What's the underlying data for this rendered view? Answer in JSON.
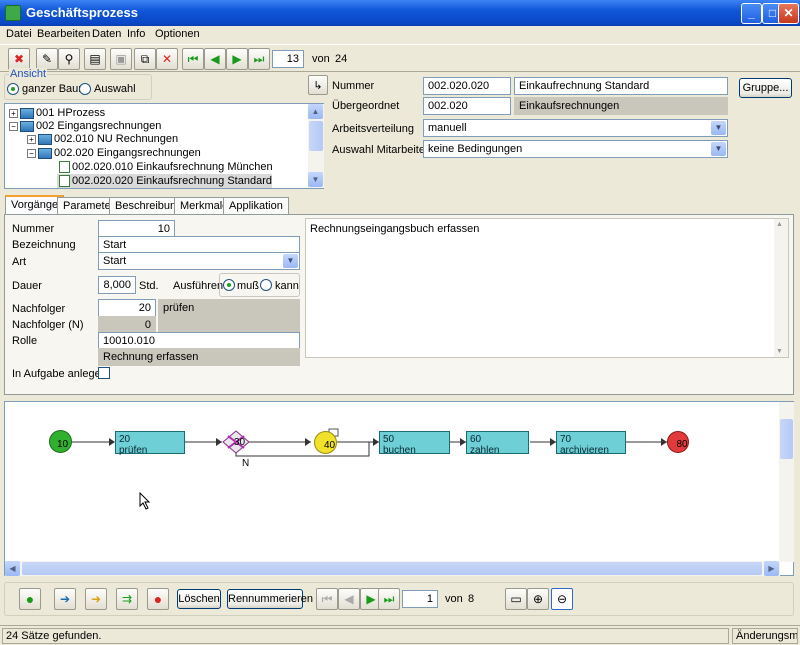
{
  "window": {
    "title": "Geschäftsprozess"
  },
  "menu": [
    "Datei",
    "Bearbeiten",
    "Daten",
    "Info",
    "Optionen"
  ],
  "nav": {
    "current": "13",
    "of_label": "von",
    "total": "24"
  },
  "ansicht": {
    "legend": "Ansicht",
    "option1": "ganzer Baum",
    "option2": "Auswahl"
  },
  "tree": {
    "items": [
      "001 HProzess",
      "002 Eingangsrechnungen",
      "002.010 NU Rechnungen",
      "002.020 Eingangsrechnungen",
      "002.020.010 Einkaufsrechnung München",
      "002.020.020 Einkaufsrechnung Standard"
    ]
  },
  "detail": {
    "nummer_label": "Nummer",
    "nummer": "002.020.020",
    "nummer_name": "Einkaufrechnung Standard",
    "uebergeordnet_label": "Übergeordnet",
    "uebergeordnet": "002.020",
    "uebergeordnet_name": "Einkaufsrechnungen",
    "arbeitsverteilung_label": "Arbeitsverteilung",
    "arbeitsverteilung": "manuell",
    "auswahl_label": "Auswahl Mitarbeiter",
    "auswahl": "keine Bedingungen",
    "gruppe_button": "Gruppe..."
  },
  "tabs": [
    "Vorgänge",
    "Parameter",
    "Beschreibung",
    "Merkmale",
    "Applikation"
  ],
  "form": {
    "nummer_label": "Nummer",
    "nummer": "10",
    "bezeichnung_label": "Bezeichnung",
    "bezeichnung": "Start",
    "art_label": "Art",
    "art": "Start",
    "dauer_label": "Dauer",
    "dauer": "8,000",
    "dauer_unit": "Std.",
    "ausfuehren_label": "Ausführen",
    "opt_muss": "muß",
    "opt_kann": "kann",
    "nachfolger_label": "Nachfolger",
    "nachfolger": "20",
    "nachfolger_name": "prüfen",
    "nachfolger_n_label": "Nachfolger (N)",
    "nachfolger_n": "0",
    "rolle_label": "Rolle",
    "rolle": "10010.010",
    "rolle_name": "Rechnung erfassen",
    "aufgabe_label": "In Aufgabe anlegen",
    "description": "Rechnungseingangsbuch erfassen"
  },
  "diagram": {
    "start": "10",
    "pruefen_num": "20",
    "pruefen_label": "prüfen",
    "decision": "30",
    "decision_n": "N",
    "event": "40",
    "buchen_num": "50",
    "buchen_label": "buchen",
    "zahlen_num": "60",
    "zahlen_label": "zahlen",
    "archiv_num": "70",
    "archiv_label": "archivieren",
    "end": "80"
  },
  "bottom": {
    "delete_button": "Löschen",
    "renumber_button": "Rennummerieren",
    "current": "1",
    "of_label": "von",
    "total": "8"
  },
  "status": {
    "left": "24 Sätze gefunden.",
    "right": "Änderungsmo"
  },
  "colors": {
    "start": "#2fb02f",
    "end": "#e23a3a",
    "task": "#6ecfd6",
    "event": "#f0e22a"
  }
}
